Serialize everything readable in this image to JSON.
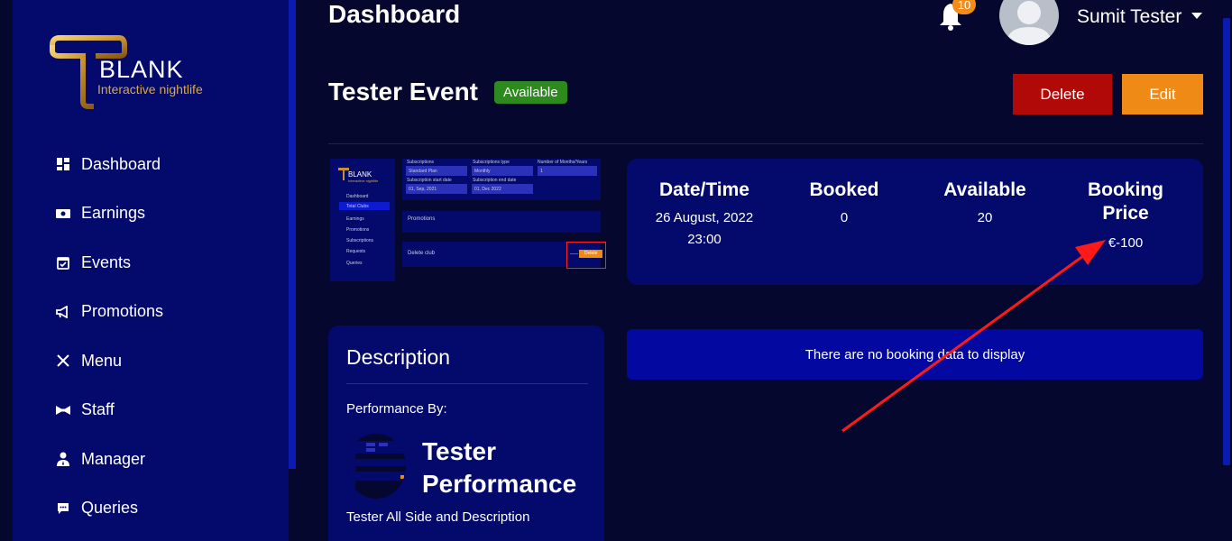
{
  "brand": {
    "name": "BLANK",
    "tagline": "Interactive nightlife"
  },
  "sidebar": {
    "items": [
      {
        "label": "Dashboard",
        "icon": "dashboard-icon"
      },
      {
        "label": "Earnings",
        "icon": "money-icon"
      },
      {
        "label": "Events",
        "icon": "calendar-icon"
      },
      {
        "label": "Promotions",
        "icon": "megaphone-icon"
      },
      {
        "label": "Menu",
        "icon": "utensils-icon"
      },
      {
        "label": "Staff",
        "icon": "bowtie-icon"
      },
      {
        "label": "Manager",
        "icon": "user-tie-icon"
      },
      {
        "label": "Queries",
        "icon": "chat-icon"
      }
    ]
  },
  "header": {
    "title": "Dashboard",
    "notification_count": "10",
    "user_name": "Sumit Tester"
  },
  "event": {
    "title": "Tester Event",
    "status": "Available",
    "delete_label": "Delete",
    "edit_label": "Edit"
  },
  "thumbnail": {
    "nav": [
      "Dashboard",
      "Total Clubs",
      "Earnings",
      "Promotions",
      "Subscriptions",
      "Requests",
      "Queries"
    ],
    "fields": [
      "Subscriptions",
      "Subscriptions type",
      "Number of Months/Years",
      "Subscription start date",
      "Subscription end date"
    ],
    "values": [
      "Standard Plan",
      "Monthly",
      "1",
      "01, Sep, 2021",
      "01, Dec 2022"
    ],
    "promotions": "Promotions",
    "delete_club": "Delete club",
    "delete_btn": "Delete"
  },
  "stats": {
    "datetime_label": "Date/Time",
    "date": "26 August, 2022",
    "time": "23:00",
    "booked_label": "Booked",
    "booked": "0",
    "available_label": "Available",
    "available": "20",
    "price_label_1": "Booking",
    "price_label_2": "Price",
    "price": "€-100"
  },
  "description": {
    "title": "Description",
    "performance_by": "Performance By:",
    "performer_line1": "Tester",
    "performer_line2": "Performance",
    "text": "Tester All Side and Description"
  },
  "booking": {
    "empty_message": "There are no booking data to display"
  },
  "colors": {
    "background": "#05072e",
    "sidebar": "#030a6b",
    "available_badge": "#2d8a1f",
    "delete": "#b10808",
    "edit": "#ef8a16",
    "annotation_arrow": "#ff1a1a"
  }
}
